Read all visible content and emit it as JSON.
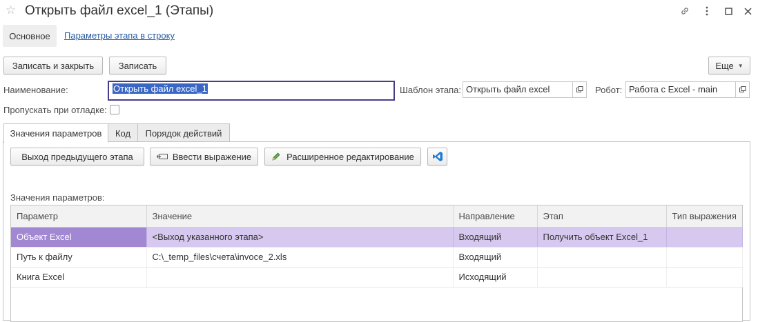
{
  "window": {
    "title": "Открыть файл excel_1 (Этапы)"
  },
  "nav": {
    "main_tab": "Основное",
    "link": "Параметры этапа в строку"
  },
  "toolbar": {
    "save_close": "Записать и закрыть",
    "save": "Записать",
    "more": "Еще"
  },
  "form": {
    "name_label": "Наименование:",
    "name_value": "Открыть файл excel_1",
    "template_label": "Шаблон этапа:",
    "template_value": "Открыть файл excel",
    "robot_label": "Робот:",
    "robot_value": "Работа с Excel - main",
    "skip_label": "Пропускать при отладке:"
  },
  "tabs": [
    {
      "label": "Значения параметров",
      "active": true
    },
    {
      "label": "Код",
      "active": false
    },
    {
      "label": "Порядок действий",
      "active": false
    }
  ],
  "panel": {
    "btn_prev_output": "Выход предыдущего этапа",
    "btn_expression": "Ввести выражение",
    "btn_advanced": "Расширенное редактирование",
    "params_label": "Значения параметров:"
  },
  "table": {
    "columns": [
      "Параметр",
      "Значение",
      "Направление",
      "Этап",
      "Тип выражения"
    ],
    "rows": [
      [
        "Объект Excel",
        "<Выход указанного этапа>",
        "Входящий",
        "Получить объект Excel_1",
        ""
      ],
      [
        "Путь к файлу",
        "C:\\_temp_files\\счета\\invoce_2.xls",
        "Входящий",
        "",
        ""
      ],
      [
        "Книга Excel",
        "",
        "Исходящий",
        "",
        ""
      ]
    ],
    "selected_row": 0
  },
  "colors": {
    "accent_focus": "#4b3a8b",
    "selection_row": "#d6c8ef",
    "selection_cell": "#a287d2",
    "link": "#2a5b9f",
    "vscode_blue": "#1f7bd1"
  }
}
